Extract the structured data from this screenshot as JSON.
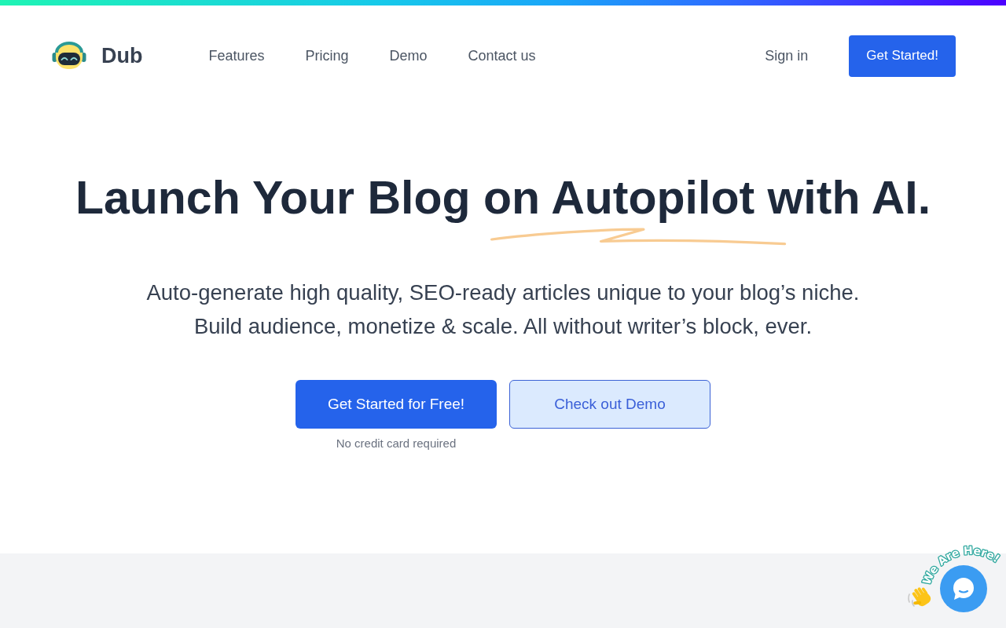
{
  "header": {
    "brand": "Dub",
    "links": [
      {
        "label": "Features"
      },
      {
        "label": "Pricing"
      },
      {
        "label": "Demo"
      },
      {
        "label": "Contact us"
      }
    ],
    "sign_in": "Sign in",
    "cta": "Get Started!"
  },
  "hero": {
    "title": {
      "lead": "Launch Your Blog on ",
      "underlined_word": "Autopilot",
      "tail": " with AI."
    },
    "subtitle_lines": [
      "Auto-generate high quality, SEO-ready articles unique to your blog’s niche.",
      "Build audience, monetize & scale. All without writer’s block, ever."
    ],
    "primary_button": "Get Started for Free!",
    "secondary_button": "Check out Demo",
    "note": "No credit card required"
  },
  "chat_widget": {
    "badge": "We Are Here!"
  }
}
